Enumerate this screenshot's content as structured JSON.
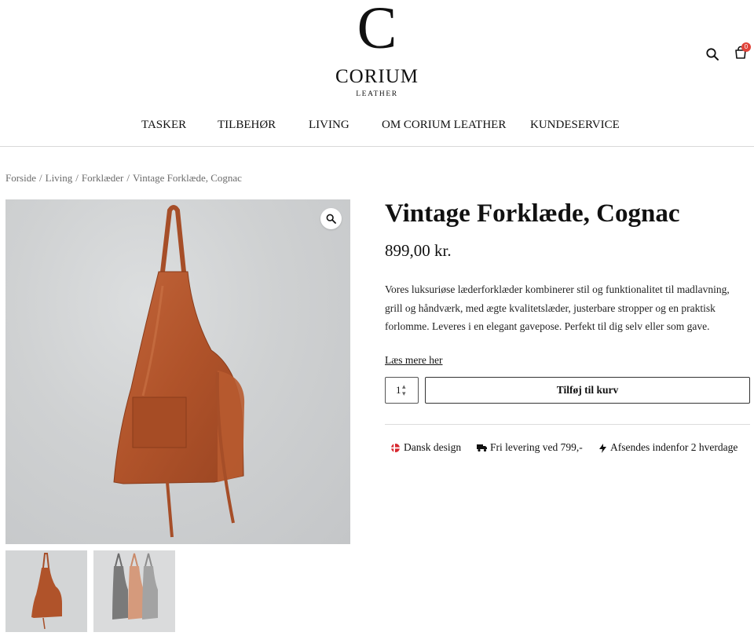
{
  "brand": {
    "logo_letter": "C",
    "name": "CORIUM",
    "tagline": "LEATHER"
  },
  "header": {
    "cart_count": "0"
  },
  "nav": {
    "items": [
      "TASKER",
      "TILBEHØR",
      "LIVING",
      "OM CORIUM LEATHER",
      "KUNDESERVICE"
    ]
  },
  "breadcrumb": {
    "items": [
      "Forside",
      "Living",
      "Forklæder",
      "Vintage Forklæde, Cognac"
    ],
    "separator": "/"
  },
  "product": {
    "title": "Vintage Forklæde, Cognac",
    "price": "899,00 kr.",
    "description_lines": [
      "Vores luksuriøse læderforklæder kombinerer stil og funktionalitet til madlavning,",
      "grill og håndværk, med ægte kvalitetslæder, justerbare stropper og en praktisk",
      "forlomme. Leveres i en elegant gavepose. Perfekt til dig selv eller som gave."
    ],
    "read_more": "Læs mere her",
    "quantity": "1",
    "add_to_cart": "Tilføj til kurv"
  },
  "usps": [
    {
      "icon": "danish-flag-icon",
      "text": "Dansk design"
    },
    {
      "icon": "truck-icon",
      "text": "Fri levering ved 799,-"
    },
    {
      "icon": "lightning-icon",
      "text": "Afsendes indenfor 2 hverdage"
    }
  ],
  "colors": {
    "accent": "#e0433a",
    "leather": "#b0532a",
    "image_bg": "#cfd1d2"
  }
}
